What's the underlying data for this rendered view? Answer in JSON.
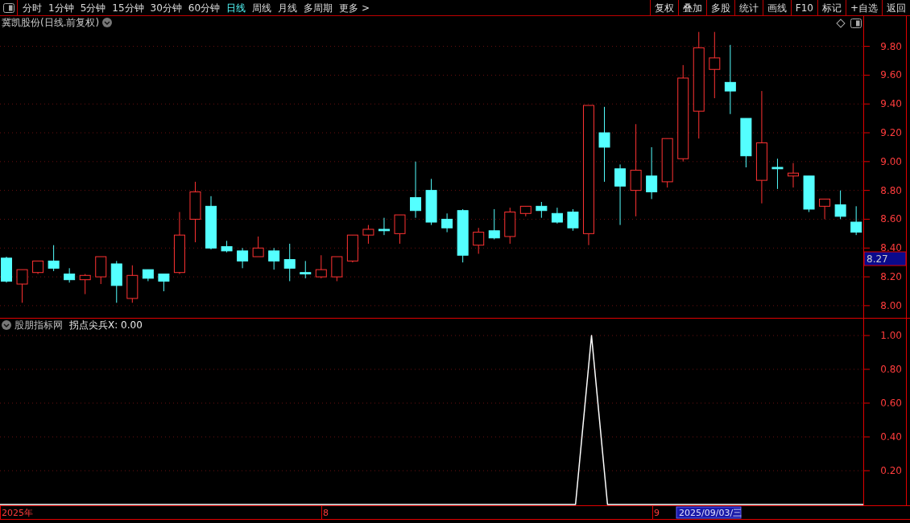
{
  "toolbar": {
    "periods": [
      {
        "label": "分时",
        "selected": false
      },
      {
        "label": "1分钟",
        "selected": false
      },
      {
        "label": "5分钟",
        "selected": false
      },
      {
        "label": "15分钟",
        "selected": false
      },
      {
        "label": "30分钟",
        "selected": false
      },
      {
        "label": "60分钟",
        "selected": false
      },
      {
        "label": "日线",
        "selected": true
      },
      {
        "label": "周线",
        "selected": false
      },
      {
        "label": "月线",
        "selected": false
      },
      {
        "label": "多周期",
        "selected": false
      },
      {
        "label": "更多 >",
        "selected": false
      }
    ],
    "buttons": [
      "复权",
      "叠加",
      "多股",
      "统计",
      "画线",
      "F10",
      "标记",
      "+自选",
      "返回"
    ]
  },
  "price_panel": {
    "title": "冀凯股份(日线.前复权)",
    "last_price": "8.27",
    "chart_data": {
      "type": "candlestick",
      "grid": true,
      "ylim": [
        7.91,
        10.01
      ],
      "yticks": [
        {
          "value": 8.0,
          "label": "8.00"
        },
        {
          "value": 8.2,
          "label": "8.20"
        },
        {
          "value": 8.4,
          "label": "8.40"
        },
        {
          "value": 8.6,
          "label": "8.60"
        },
        {
          "value": 8.8,
          "label": "8.80"
        },
        {
          "value": 9.0,
          "label": "9.00"
        },
        {
          "value": 9.2,
          "label": "9.20"
        },
        {
          "value": 9.4,
          "label": "9.40"
        },
        {
          "value": 9.6,
          "label": "9.60"
        },
        {
          "value": 9.8,
          "label": "9.80"
        }
      ],
      "ohlc": [
        [
          8.33,
          8.34,
          8.16,
          8.17
        ],
        [
          8.15,
          8.25,
          8.02,
          8.25
        ],
        [
          8.23,
          8.31,
          8.22,
          8.31
        ],
        [
          8.31,
          8.42,
          8.24,
          8.26
        ],
        [
          8.22,
          8.26,
          8.16,
          8.18
        ],
        [
          8.18,
          8.22,
          8.08,
          8.21
        ],
        [
          8.2,
          8.34,
          8.15,
          8.34
        ],
        [
          8.29,
          8.31,
          8.02,
          8.14
        ],
        [
          8.05,
          8.28,
          8.02,
          8.21
        ],
        [
          8.25,
          8.25,
          8.17,
          8.19
        ],
        [
          8.22,
          8.22,
          8.1,
          8.17
        ],
        [
          8.23,
          8.65,
          8.22,
          8.49
        ],
        [
          8.6,
          8.86,
          8.44,
          8.79
        ],
        [
          8.69,
          8.76,
          8.39,
          8.4
        ],
        [
          8.41,
          8.45,
          8.37,
          8.38
        ],
        [
          8.38,
          8.4,
          8.26,
          8.31
        ],
        [
          8.34,
          8.48,
          8.34,
          8.4
        ],
        [
          8.38,
          8.4,
          8.25,
          8.31
        ],
        [
          8.32,
          8.43,
          8.17,
          8.26
        ],
        [
          8.23,
          8.31,
          8.19,
          8.22
        ],
        [
          8.2,
          8.35,
          8.19,
          8.25
        ],
        [
          8.2,
          8.34,
          8.17,
          8.34
        ],
        [
          8.31,
          8.49,
          8.3,
          8.49
        ],
        [
          8.49,
          8.56,
          8.43,
          8.53
        ],
        [
          8.53,
          8.61,
          8.49,
          8.52
        ],
        [
          8.5,
          8.63,
          8.43,
          8.63
        ],
        [
          8.75,
          9.0,
          8.61,
          8.66
        ],
        [
          8.8,
          8.88,
          8.56,
          8.58
        ],
        [
          8.6,
          8.64,
          8.51,
          8.54
        ],
        [
          8.66,
          8.67,
          8.3,
          8.35
        ],
        [
          8.42,
          8.54,
          8.36,
          8.51
        ],
        [
          8.52,
          8.67,
          8.46,
          8.47
        ],
        [
          8.48,
          8.68,
          8.43,
          8.65
        ],
        [
          8.64,
          8.69,
          8.62,
          8.69
        ],
        [
          8.69,
          8.72,
          8.61,
          8.66
        ],
        [
          8.64,
          8.68,
          8.57,
          8.58
        ],
        [
          8.65,
          8.67,
          8.52,
          8.54
        ],
        [
          8.5,
          9.39,
          8.42,
          9.39
        ],
        [
          9.2,
          9.38,
          8.86,
          9.1
        ],
        [
          8.95,
          8.98,
          8.56,
          8.83
        ],
        [
          8.8,
          9.26,
          8.62,
          8.94
        ],
        [
          8.9,
          9.1,
          8.74,
          8.79
        ],
        [
          8.86,
          9.16,
          8.82,
          9.16
        ],
        [
          9.02,
          9.67,
          9.0,
          9.58
        ],
        [
          9.35,
          9.9,
          9.16,
          9.79
        ],
        [
          9.64,
          9.9,
          9.44,
          9.72
        ],
        [
          9.55,
          9.81,
          9.33,
          9.49
        ],
        [
          9.3,
          9.3,
          8.96,
          9.04
        ],
        [
          8.87,
          9.49,
          8.71,
          9.13
        ],
        [
          8.96,
          9.02,
          8.81,
          8.95
        ],
        [
          8.9,
          8.99,
          8.82,
          8.92
        ],
        [
          8.9,
          8.9,
          8.65,
          8.67
        ],
        [
          8.69,
          8.74,
          8.6,
          8.74
        ],
        [
          8.7,
          8.8,
          8.6,
          8.62
        ],
        [
          8.58,
          8.69,
          8.49,
          8.51
        ]
      ]
    }
  },
  "indicator_panel": {
    "source": "股朋指标网",
    "label": "拐点尖兵X: 0.00",
    "chart_data": {
      "type": "line",
      "grid": true,
      "ylim": [
        0,
        1.1
      ],
      "yticks": [
        {
          "value": 0.2,
          "label": "0.20"
        },
        {
          "value": 0.4,
          "label": "0.40"
        },
        {
          "value": 0.6,
          "label": "0.60"
        },
        {
          "value": 0.8,
          "label": "0.80"
        },
        {
          "value": 1.0,
          "label": "1.00"
        }
      ],
      "values": [
        0,
        0,
        0,
        0,
        0,
        0,
        0,
        0,
        0,
        0,
        0,
        0,
        0,
        0,
        0,
        0,
        0,
        0,
        0,
        0,
        0,
        0,
        0,
        0,
        0,
        0,
        0,
        0,
        0,
        0,
        0,
        0,
        0,
        0,
        0,
        0,
        0,
        1,
        0,
        0,
        0,
        0,
        0,
        0,
        0,
        0,
        0,
        0,
        0,
        0,
        0,
        0,
        0,
        0,
        0
      ]
    }
  },
  "date_axis": {
    "labels": [
      {
        "text": "2025年"
      },
      {
        "text": "8"
      },
      {
        "text": "9"
      }
    ],
    "cursor_date": "2025/09/03/三"
  }
}
